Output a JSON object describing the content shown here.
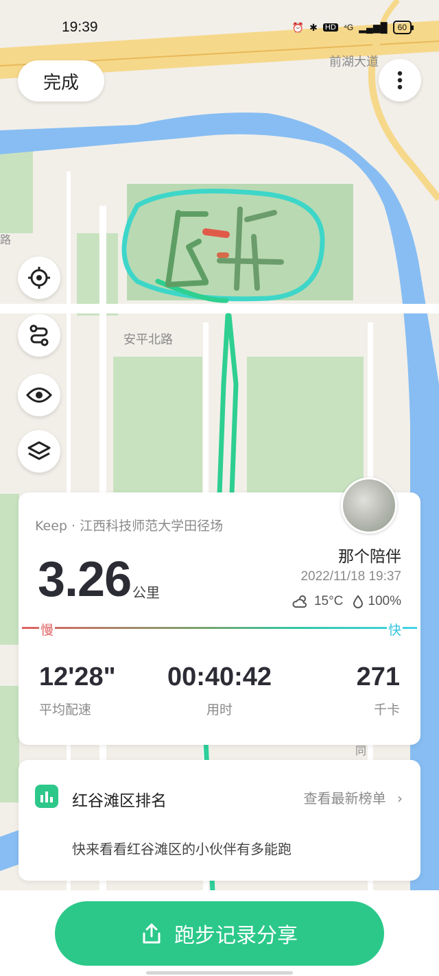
{
  "status_bar": {
    "time": "19:39",
    "hd": "HD",
    "network": "⁴G",
    "battery": "60"
  },
  "map": {
    "road_label_top": "前湖大道",
    "road_label_mid": "安平北路",
    "road_label_left": "路",
    "road_label_right": "同"
  },
  "header": {
    "done_label": "完成"
  },
  "icons": {
    "more": "more-vertical-icon",
    "locate": "locate-icon",
    "route": "route-icon",
    "eye": "eye-icon",
    "layers": "layers-icon"
  },
  "summary": {
    "subtitle": "Keep · 江西科技师范大学田径场",
    "distance": "3.26",
    "distance_unit": "公里",
    "username": "那个陪伴",
    "datetime": "2022/11/18 19:37",
    "temperature": "15°C",
    "humidity": "100%",
    "pace_slow": "慢",
    "pace_fast": "快",
    "metrics": [
      {
        "value": "12'28\"",
        "label": "平均配速"
      },
      {
        "value": "00:40:42",
        "label": "用时"
      },
      {
        "value": "271",
        "label": "千卡"
      }
    ]
  },
  "ranking": {
    "title": "红谷滩区排名",
    "link": "查看最新榜单",
    "description": "快来看看红谷滩区的小伙伴有多能跑"
  },
  "share": {
    "label": "跑步记录分享"
  },
  "colors": {
    "accent": "#2bc88a",
    "route": "#2fcf9a",
    "route_light": "#3fd6d8",
    "water": "#7fb6ef"
  }
}
